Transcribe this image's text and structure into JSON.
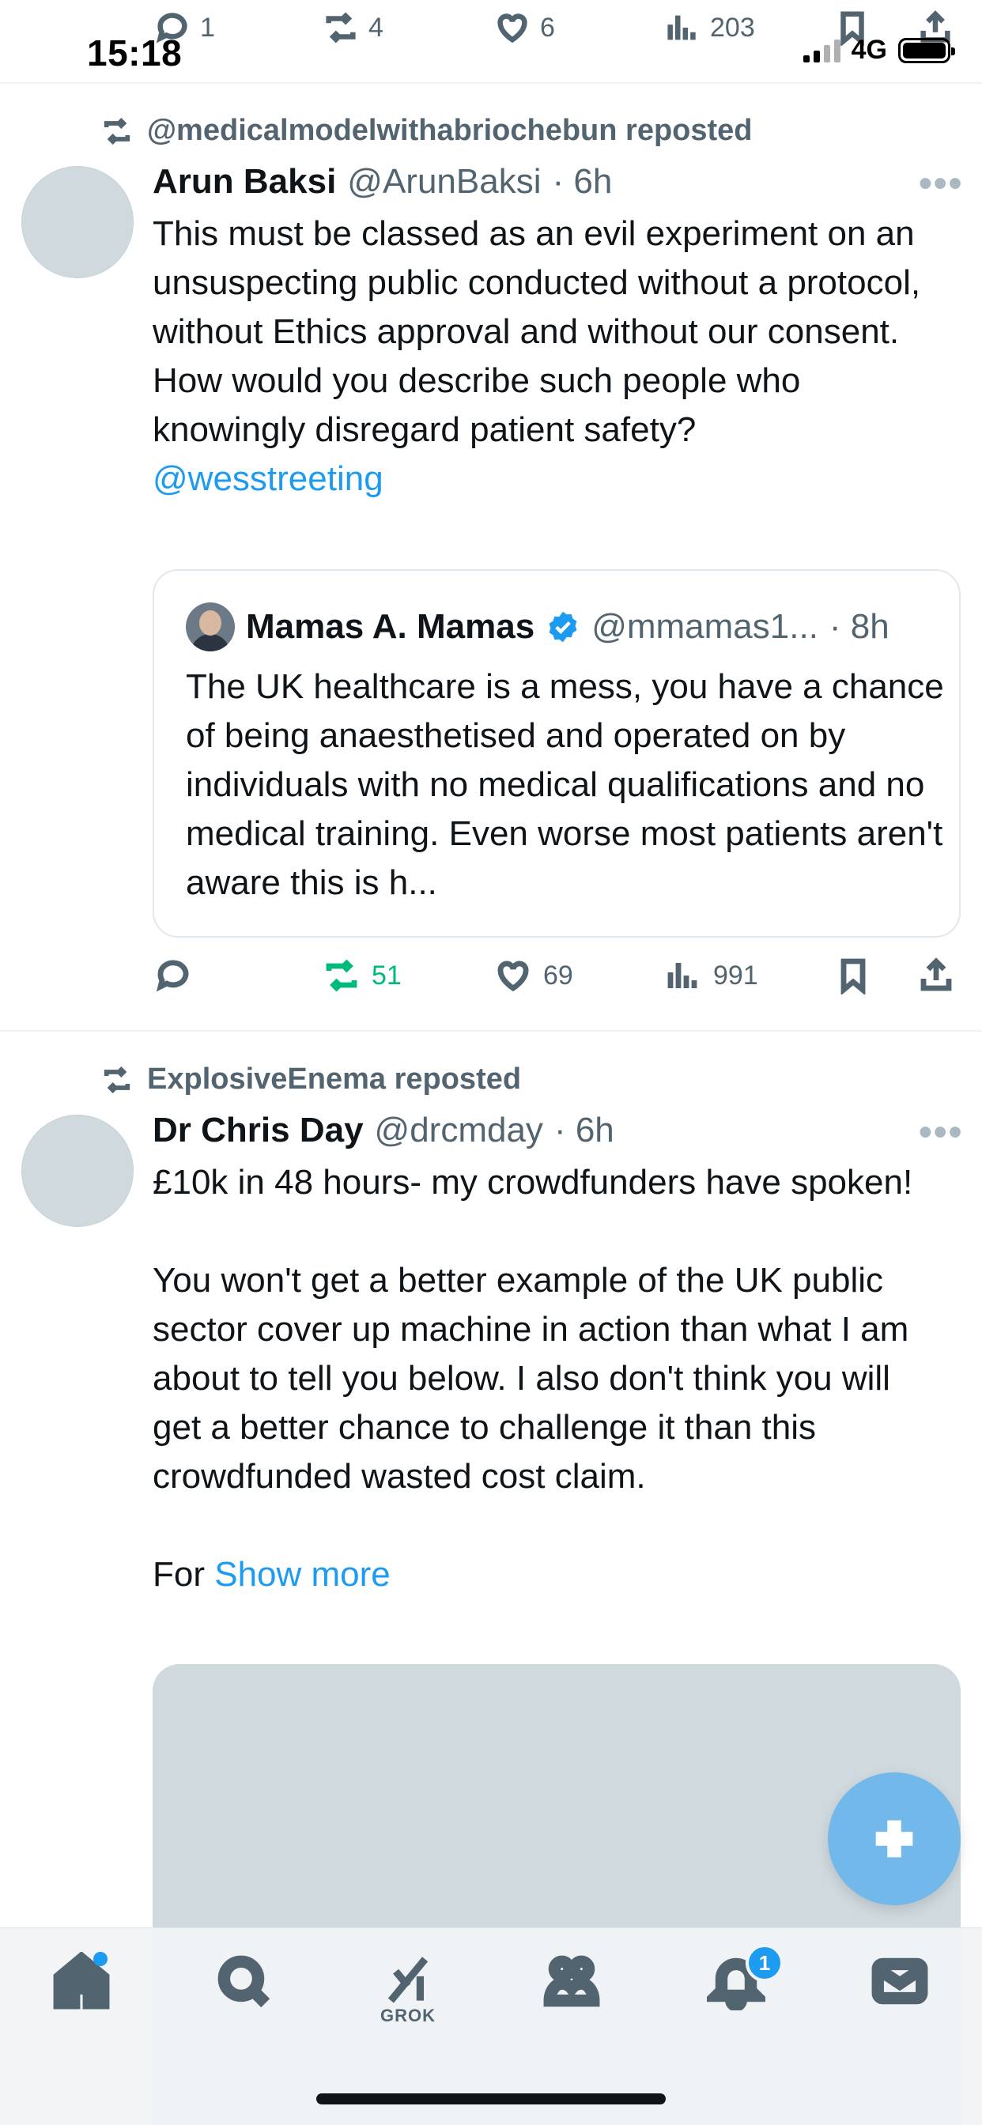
{
  "status_bar": {
    "time": "15:18",
    "network": "4G"
  },
  "previous_tweet_actions": {
    "replies": "1",
    "reposts": "4",
    "likes": "6",
    "views": "203"
  },
  "tweets": [
    {
      "repost_by": "@medicalmodelwithabriochebun reposted",
      "name": "Arun Baksi",
      "handle": "@ArunBaksi",
      "time": "· 6h",
      "text": "This must be classed as an evil experiment on an unsuspecting public conducted without a protocol, without Ethics approval and without our consent.\nHow would you describe such people who knowingly disregard patient safety?",
      "mention": "@wesstreeting",
      "quote": {
        "name": "Mamas A. Mamas",
        "handle": "@mmamas1...",
        "time": "· 8h",
        "text": "The UK healthcare is a mess, you have a chance of being anaesthetised and operated on by individuals with no medical qualifications and no medical training. Even worse most patients aren't aware this is h..."
      },
      "actions": {
        "replies": "",
        "reposts": "51",
        "likes": "69",
        "views": "991"
      }
    },
    {
      "repost_by": "ExplosiveEnema reposted",
      "name": "Dr Chris Day",
      "handle": "@drcmday",
      "time": "· 6h",
      "text": "£10k in 48 hours- my crowdfunders have spoken!\n\nYou won't get a better example of the UK public sector cover up machine in action than what I am about to tell you below. I also don't think you will get a better chance to challenge it than this crowdfunded wasted cost claim.\n\nFor ",
      "show_more": "Show more"
    }
  ],
  "tabbar": {
    "grok_label": "GROK",
    "notification_count": "1"
  },
  "colors": {
    "accent": "#1d9bf0",
    "repost_green": "#00ba7c",
    "secondary_text": "#536471"
  }
}
